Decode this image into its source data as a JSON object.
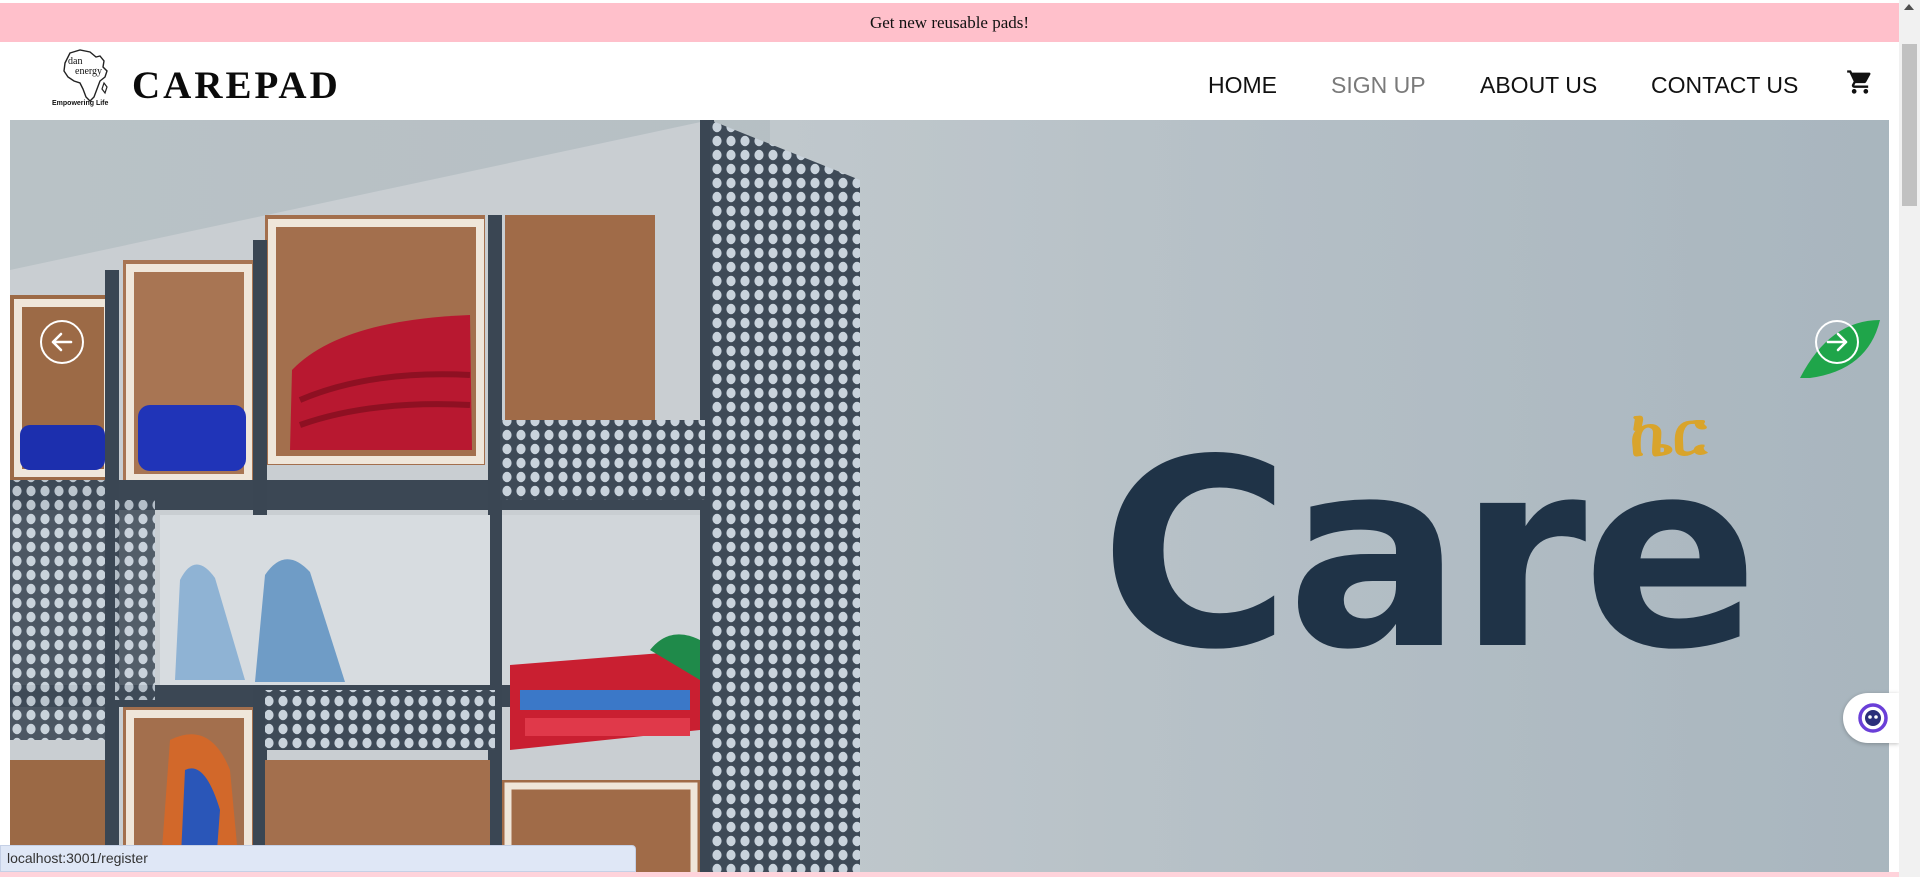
{
  "announcement": {
    "text": "Get new reusable pads!"
  },
  "header": {
    "logo": {
      "line1": "dan",
      "line2": "energy",
      "tagline": "Empowering Life"
    },
    "brand": "CAREPAD",
    "nav": [
      {
        "label": "HOME"
      },
      {
        "label": "SIGN UP",
        "state": "hovered"
      },
      {
        "label": "ABOUT US"
      },
      {
        "label": "CONTACT US"
      }
    ],
    "cart_icon": "cart-icon"
  },
  "hero": {
    "wall_sign": {
      "main": "Care",
      "accent": "ኬር"
    },
    "prev_icon": "arrow-left-circle-icon",
    "next_icon": "arrow-right-circle-icon"
  },
  "chat_widget": {
    "icon": "chat-bot-icon"
  },
  "status_bar": {
    "url": "localhost:3001/register"
  },
  "colors": {
    "announcement_bg": "#ffc0cb",
    "nav_text": "#111111",
    "nav_hover": "#7a7a7a",
    "sign_dark": "#1f3347",
    "sign_accent": "#d9a42b",
    "leaf_green": "#1fa54a"
  }
}
